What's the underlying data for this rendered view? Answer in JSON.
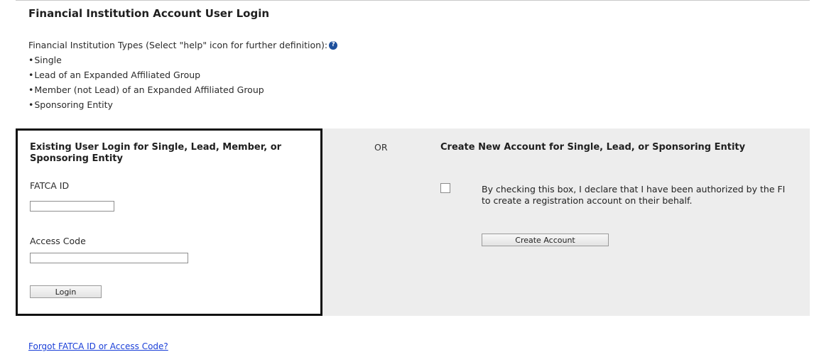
{
  "page": {
    "title": "Financial Institution Account User Login",
    "types_intro": "Financial Institution Types (Select \"help\" icon for further definition):",
    "help_icon": "help-icon",
    "types": [
      "Single",
      "Lead of an Expanded Affiliated Group",
      "Member (not Lead) of an Expanded Affiliated Group",
      "Sponsoring Entity"
    ]
  },
  "login": {
    "heading": "Existing User Login for Single, Lead, Member, or Sponsoring Entity",
    "fatca_id_label": "FATCA ID",
    "fatca_id_value": "",
    "access_code_label": "Access Code",
    "access_code_value": "",
    "login_button": "Login"
  },
  "separator": {
    "or_text": "OR"
  },
  "create": {
    "heading": "Create New Account for Single, Lead, or Sponsoring Entity",
    "declaration": "By checking this box, I declare that I have been authorized by the FI to create a registration account on their behalf.",
    "checkbox_checked": false,
    "create_button": "Create Account"
  },
  "footer": {
    "forgot_link": "Forgot FATCA ID or Access Code?"
  },
  "colors": {
    "panel_bg": "#ededed",
    "link": "#1a3fd8",
    "help_icon": "#1d4f9c",
    "login_border": "#111111"
  }
}
